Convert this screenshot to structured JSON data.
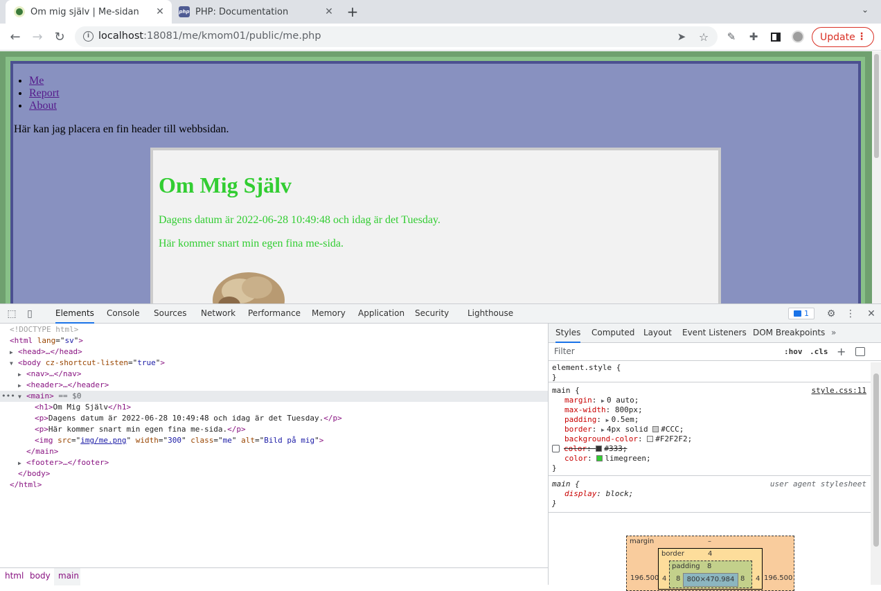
{
  "browser": {
    "tabs": [
      {
        "title": "Om mig själv | Me-sidan",
        "active": true
      },
      {
        "title": "PHP: Documentation",
        "active": false
      }
    ],
    "url_host": "localhost",
    "url_rest": ":18081/me/kmom01/public/me.php",
    "update_label": "Update"
  },
  "page": {
    "nav": [
      "Me",
      "Report",
      "About"
    ],
    "header_text": "Här kan jag placera en fin header till webbsidan.",
    "h1": "Om Mig Själv",
    "p1": "Dagens datum är 2022-06-28 10:49:48 och idag är det Tuesday.",
    "p2": "Här kommer snart min egen fina me-sida."
  },
  "devtools": {
    "tabs": [
      "Elements",
      "Console",
      "Sources",
      "Network",
      "Performance",
      "Memory",
      "Application",
      "Security",
      "Lighthouse"
    ],
    "issues_count": "1",
    "dom": {
      "doctype": "<!DOCTYPE html>",
      "html_open": "html",
      "html_attr": "lang",
      "html_val": "sv",
      "head": "<head>…</head>",
      "body_attr": "cz-shortcut-listen",
      "body_val": "true",
      "nav": "<nav>…</nav>",
      "header": "<header>…</header>",
      "main_sel": "== $0",
      "h1_text": "Om Mig Själv",
      "p1_text": "Dagens datum är 2022-06-28 10:49:48 och idag är det Tuesday.",
      "p2_text": "Här kommer snart min egen fina me-sida.",
      "img_src": "img/me.png",
      "img_width": "300",
      "img_class": "me",
      "img_alt": "Bild på mig",
      "footer": "<footer>…</footer>"
    },
    "breadcrumbs": [
      "html",
      "body",
      "main"
    ],
    "styles_tabs": [
      "Styles",
      "Computed",
      "Layout",
      "Event Listeners",
      "DOM Breakpoints"
    ],
    "filter_placeholder": "Filter",
    "hov": ":hov",
    "cls": ".cls",
    "element_style": "element.style {",
    "main_rule": {
      "selector": "main {",
      "source": "style.css:11",
      "props": [
        {
          "name": "margin",
          "value": "0 auto;"
        },
        {
          "name": "max-width",
          "value": "800px;"
        },
        {
          "name": "padding",
          "value": "0.5em;"
        },
        {
          "name": "border",
          "value": "4px solid",
          "color_label": "#CCC;",
          "color": "#cccccc"
        },
        {
          "name": "background-color",
          "value": "",
          "color_label": "#F2F2F2;",
          "color": "#f2f2f2"
        },
        {
          "name": "color",
          "value": "",
          "color_label": "#333;",
          "color": "#333333",
          "struck": true
        },
        {
          "name": "color",
          "value": "",
          "color_label": "limegreen;",
          "color": "#32cd32"
        }
      ]
    },
    "ua_rule": {
      "selector": "main {",
      "source": "user agent stylesheet",
      "prop": "display",
      "value": "block;"
    },
    "box_model": {
      "margin_label": "margin",
      "margin_top": "–",
      "margin_left": "196.500",
      "margin_right": "196.500",
      "border_label": "border",
      "border_val": "4",
      "padding_label": "padding",
      "padding_val": "8",
      "content": "800×470.984"
    }
  }
}
